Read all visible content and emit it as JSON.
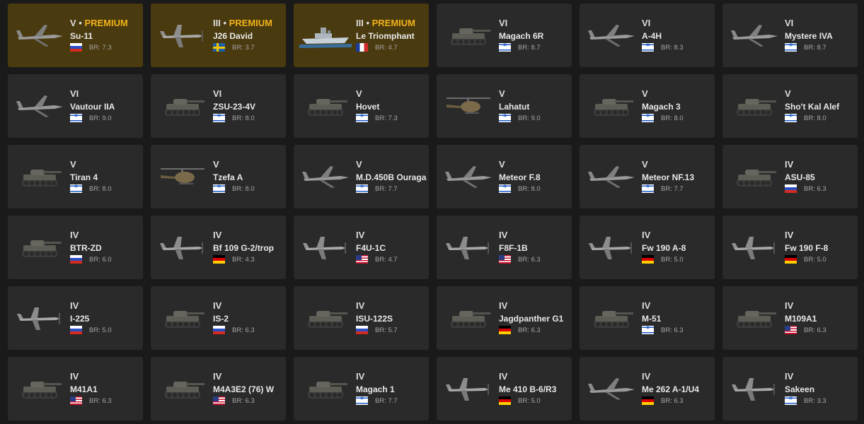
{
  "colors": {
    "background": "#1a1a1a",
    "card": "#2a2a2a",
    "premium_card": "#4a3a0f",
    "premium_text": "#f0b21a"
  },
  "vehicles": [
    {
      "tier": "V",
      "premium": "PREMIUM",
      "name": "Su-11",
      "flag": "ru",
      "br": "BR: 7.3",
      "type": "jet"
    },
    {
      "tier": "III",
      "premium": "PREMIUM",
      "name": "J26 David",
      "flag": "se",
      "br": "BR: 3.7",
      "type": "prop"
    },
    {
      "tier": "III",
      "premium": "PREMIUM",
      "name": "Le Triomphant",
      "flag": "fr",
      "br": "BR: 4.7",
      "type": "ship"
    },
    {
      "tier": "VI",
      "premium": "",
      "name": "Magach 6R",
      "flag": "il",
      "br": "BR: 8.7",
      "type": "tank"
    },
    {
      "tier": "VI",
      "premium": "",
      "name": "A-4H",
      "flag": "il",
      "br": "BR: 8.3",
      "type": "jet"
    },
    {
      "tier": "VI",
      "premium": "",
      "name": "Mystere IVA",
      "flag": "il",
      "br": "BR: 8.7",
      "type": "jet"
    },
    {
      "tier": "VI",
      "premium": "",
      "name": "Vautour IIA",
      "flag": "il",
      "br": "BR: 9.0",
      "type": "jet"
    },
    {
      "tier": "VI",
      "premium": "",
      "name": "ZSU-23-4V",
      "flag": "il",
      "br": "BR: 8.0",
      "type": "tank"
    },
    {
      "tier": "V",
      "premium": "",
      "name": "Hovet",
      "flag": "il",
      "br": "BR: 7.3",
      "type": "tank"
    },
    {
      "tier": "V",
      "premium": "",
      "name": "Lahatut",
      "flag": "il",
      "br": "BR: 9.0",
      "type": "heli"
    },
    {
      "tier": "V",
      "premium": "",
      "name": "Magach 3",
      "flag": "il",
      "br": "BR: 8.0",
      "type": "tank"
    },
    {
      "tier": "V",
      "premium": "",
      "name": "Sho't Kal Alef",
      "flag": "il",
      "br": "BR: 8.0",
      "type": "tank"
    },
    {
      "tier": "V",
      "premium": "",
      "name": "Tiran 4",
      "flag": "il",
      "br": "BR: 8.0",
      "type": "tank"
    },
    {
      "tier": "V",
      "premium": "",
      "name": "Tzefa A",
      "flag": "il",
      "br": "BR: 8.0",
      "type": "heli"
    },
    {
      "tier": "V",
      "premium": "",
      "name": "M.D.450B Ouraga",
      "flag": "il",
      "br": "BR: 7.7",
      "type": "jet"
    },
    {
      "tier": "V",
      "premium": "",
      "name": "Meteor F.8",
      "flag": "il",
      "br": "BR: 8.0",
      "type": "jet"
    },
    {
      "tier": "V",
      "premium": "",
      "name": "Meteor NF.13",
      "flag": "il",
      "br": "BR: 7.7",
      "type": "jet"
    },
    {
      "tier": "IV",
      "premium": "",
      "name": "ASU-85",
      "flag": "ru",
      "br": "BR: 6.3",
      "type": "tank"
    },
    {
      "tier": "IV",
      "premium": "",
      "name": "BTR-ZD",
      "flag": "ru",
      "br": "BR: 6.0",
      "type": "tank"
    },
    {
      "tier": "IV",
      "premium": "",
      "name": "Bf 109 G-2/trop",
      "flag": "de",
      "br": "BR: 4.3",
      "type": "prop"
    },
    {
      "tier": "IV",
      "premium": "",
      "name": "F4U-1C",
      "flag": "us",
      "br": "BR: 4.7",
      "type": "prop"
    },
    {
      "tier": "IV",
      "premium": "",
      "name": "F8F-1B",
      "flag": "us",
      "br": "BR: 6.3",
      "type": "prop"
    },
    {
      "tier": "IV",
      "premium": "",
      "name": "Fw 190 A-8",
      "flag": "de",
      "br": "BR: 5.0",
      "type": "prop"
    },
    {
      "tier": "IV",
      "premium": "",
      "name": "Fw 190 F-8",
      "flag": "de",
      "br": "BR: 5.0",
      "type": "prop"
    },
    {
      "tier": "IV",
      "premium": "",
      "name": "I-225",
      "flag": "ru",
      "br": "BR: 5.0",
      "type": "prop"
    },
    {
      "tier": "IV",
      "premium": "",
      "name": "IS-2",
      "flag": "ru",
      "br": "BR: 6.3",
      "type": "tank"
    },
    {
      "tier": "IV",
      "premium": "",
      "name": "ISU-122S",
      "flag": "ru",
      "br": "BR: 5.7",
      "type": "tank"
    },
    {
      "tier": "IV",
      "premium": "",
      "name": "Jagdpanther G1",
      "flag": "de",
      "br": "BR: 6.3",
      "type": "tank"
    },
    {
      "tier": "IV",
      "premium": "",
      "name": "M-51",
      "flag": "il",
      "br": "BR: 6.3",
      "type": "tank"
    },
    {
      "tier": "IV",
      "premium": "",
      "name": "M109A1",
      "flag": "us",
      "br": "BR: 6.3",
      "type": "tank"
    },
    {
      "tier": "IV",
      "premium": "",
      "name": "M41A1",
      "flag": "us",
      "br": "BR: 6.3",
      "type": "tank"
    },
    {
      "tier": "IV",
      "premium": "",
      "name": "M4A3E2 (76) W",
      "flag": "us",
      "br": "BR: 6.3",
      "type": "tank"
    },
    {
      "tier": "IV",
      "premium": "",
      "name": "Magach 1",
      "flag": "il",
      "br": "BR: 7.7",
      "type": "tank"
    },
    {
      "tier": "IV",
      "premium": "",
      "name": "Me 410 B-6/R3",
      "flag": "de",
      "br": "BR: 5.0",
      "type": "prop"
    },
    {
      "tier": "IV",
      "premium": "",
      "name": "Me 262 A-1/U4",
      "flag": "de",
      "br": "BR: 6.3",
      "type": "jet"
    },
    {
      "tier": "IV",
      "premium": "",
      "name": "Sakeen",
      "flag": "il",
      "br": "BR: 3.3",
      "type": "prop"
    }
  ]
}
